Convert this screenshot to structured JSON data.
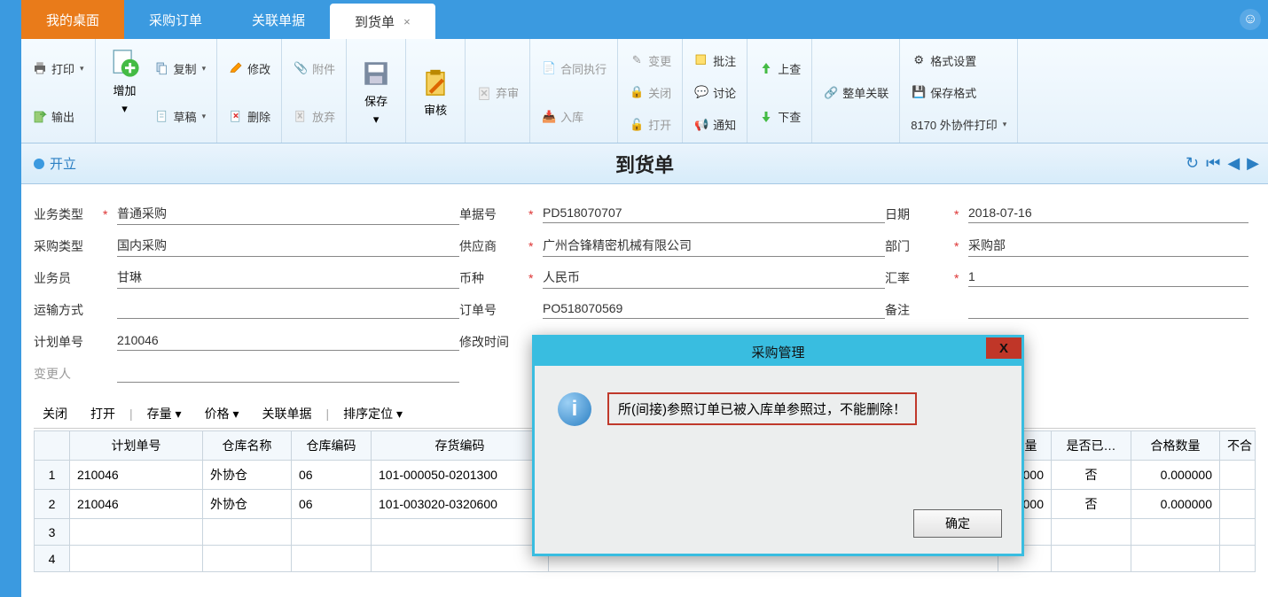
{
  "tabs": {
    "my_desktop": "我的桌面",
    "purchase_order": "采购订单",
    "related_docs": "关联单据",
    "arrival_doc": "到货单"
  },
  "ribbon": {
    "print": "打印",
    "export": "输出",
    "add": "增加",
    "copy": "复制",
    "draft": "草稿",
    "modify": "修改",
    "delete": "删除",
    "attachment": "附件",
    "abandon": "放弃",
    "save": "保存",
    "audit": "审核",
    "reject": "弃审",
    "contract_exec": "合同执行",
    "instore": "入库",
    "change": "变更",
    "close": "关闭",
    "open": "打开",
    "approve": "批注",
    "discuss": "讨论",
    "notify": "通知",
    "lookup_up": "上查",
    "lookup_down": "下查",
    "whole_rel": "整单关联",
    "format_set": "格式设置",
    "save_format": "保存格式",
    "print_tpl": "8170 外协件打印"
  },
  "title_bar": {
    "status": "开立",
    "doc_title": "到货单"
  },
  "fields": {
    "biz_type_lbl": "业务类型",
    "biz_type_val": "普通采购",
    "doc_no_lbl": "单据号",
    "doc_no_val": "PD518070707",
    "date_lbl": "日期",
    "date_val": "2018-07-16",
    "purchase_type_lbl": "采购类型",
    "purchase_type_val": "国内采购",
    "supplier_lbl": "供应商",
    "supplier_val": "广州合锋精密机械有限公司",
    "dept_lbl": "部门",
    "dept_val": "采购部",
    "salesman_lbl": "业务员",
    "salesman_val": "甘琳",
    "currency_lbl": "币种",
    "currency_val": "人民币",
    "rate_lbl": "汇率",
    "rate_val": "1",
    "transport_lbl": "运输方式",
    "transport_val": "",
    "order_no_lbl": "订单号",
    "order_no_val": "PO518070569",
    "remark_lbl": "备注",
    "remark_val": "",
    "plan_no_lbl": "计划单号",
    "plan_no_val": "210046",
    "modify_time_lbl": "修改时间",
    "change_person_lbl": "变更人"
  },
  "grid_toolbar": {
    "close": "关闭",
    "open": "打开",
    "stock": "存量",
    "price": "价格",
    "related": "关联单据",
    "sort": "排序定位"
  },
  "cols": {
    "plan_no": "计划单号",
    "whs_name": "仓库名称",
    "whs_code": "仓库编码",
    "inv_code": "存货编码",
    "qty": "数量",
    "is_done": "是否已…",
    "ok_qty": "合格数量",
    "not": "不合"
  },
  "rows": [
    {
      "plan_no": "210046",
      "whs_name": "外协仓",
      "whs_code": "06",
      "inv_code": "101-000050-0201300",
      "qty": "00000",
      "is_done": "否",
      "ok_qty": "0.000000"
    },
    {
      "plan_no": "210046",
      "whs_name": "外协仓",
      "whs_code": "06",
      "inv_code": "101-003020-0320600",
      "qty": "00000",
      "is_done": "否",
      "ok_qty": "0.000000"
    }
  ],
  "modal": {
    "title": "采购管理",
    "message": "所(间接)参照订单已被入库单参照过，不能删除！",
    "ok": "确定",
    "close": "X"
  }
}
